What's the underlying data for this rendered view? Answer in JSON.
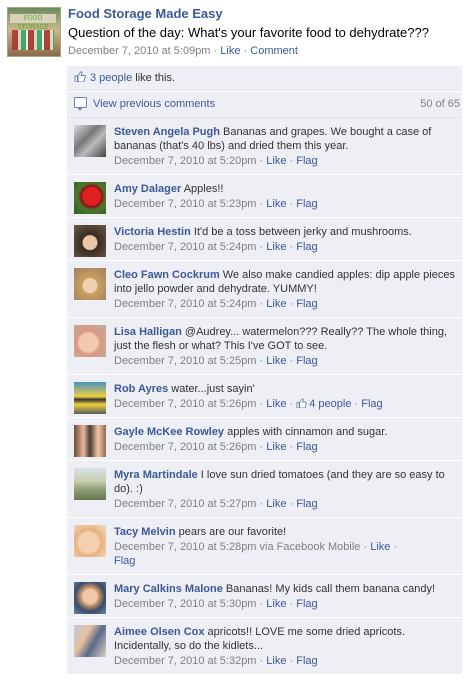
{
  "post": {
    "page_name": "Food Storage Made Easy",
    "text": "Question of the day: What's your favorite food to dehydrate???",
    "timestamp": "December 7, 2010 at 5:09pm",
    "like_label": "Like",
    "comment_label": "Comment",
    "avatar_text": "FOOD STORAGE MADE EASY"
  },
  "likes": {
    "people_link": "3 people",
    "suffix": " like this."
  },
  "prev": {
    "label": "View previous comments",
    "count": "50 of 65"
  },
  "colors": {
    "link": "#3b5998",
    "bg": "#edeff4",
    "meta": "#808080"
  },
  "comments": [
    {
      "author": "Steven Angela Pugh",
      "text": " Bananas and grapes. We bought a case of bananas (that's 40 lbs) and dried them this year.",
      "time": "December 7, 2010 at 5:20pm",
      "like": "Like",
      "flag": "Flag",
      "avatar": "bw-couple"
    },
    {
      "author": "Amy Dalager",
      "text": " Apples!!",
      "time": "December 7, 2010 at 5:23pm",
      "like": "Like",
      "flag": "Flag",
      "avatar": "red-rose"
    },
    {
      "author": "Victoria Hestin",
      "text": " It'd be a toss between jerky and mushrooms.",
      "time": "December 7, 2010 at 5:24pm",
      "like": "Like",
      "flag": "Flag",
      "avatar": "dark-hair"
    },
    {
      "author": "Cleo Fawn Cockrum",
      "text": " We also make candied apples: dip apple pieces into jello powder and dehydrate. YUMMY!",
      "time": "December 7, 2010 at 5:24pm",
      "like": "Like",
      "flag": "Flag",
      "avatar": "blonde"
    },
    {
      "author": "Lisa Halligan",
      "text": " @Audrey... watermelon??? Really?? The whole thing, just the flesh or what? This I've GOT to see.",
      "time": "December 7, 2010 at 5:25pm",
      "like": "Like",
      "flag": "Flag",
      "avatar": "baby"
    },
    {
      "author": "Rob Ayres",
      "text": " water...just sayin'",
      "time": "December 7, 2010 at 5:26pm",
      "like": "Like",
      "likes": "4 people",
      "flag": "Flag",
      "avatar": "cartoon"
    },
    {
      "author": "Gayle McKee Rowley",
      "text": " apples with cinnamon and sugar.",
      "time": "December 7, 2010 at 5:26pm",
      "like": "Like",
      "flag": "Flag",
      "avatar": "two-women"
    },
    {
      "author": "Myra Martindale",
      "text": " I love sun dried tomatoes (and they are so easy to do). :)",
      "time": "December 7, 2010 at 5:27pm",
      "like": "Like",
      "flag": "Flag",
      "avatar": "outdoor"
    },
    {
      "author": "Tacy Melvin",
      "text": " pears are our favorite!",
      "time": "December 7, 2010 at 5:28pm via Facebook Mobile",
      "like": "Like",
      "flag": "Flag",
      "avatar": "child",
      "wrap_flag": true
    },
    {
      "author": "Mary Calkins Malone",
      "text": " Bananas! My kids call them banana candy!",
      "time": "December 7, 2010 at 5:30pm",
      "like": "Like",
      "flag": "Flag",
      "avatar": "older-woman"
    },
    {
      "author": "Aimee Olsen Cox",
      "text": " apricots!! LOVE me some dried apricots. Incidentally, so do the kidlets...",
      "time": "December 7, 2010 at 5:32pm",
      "like": "Like",
      "flag": "Flag",
      "avatar": "family"
    }
  ]
}
